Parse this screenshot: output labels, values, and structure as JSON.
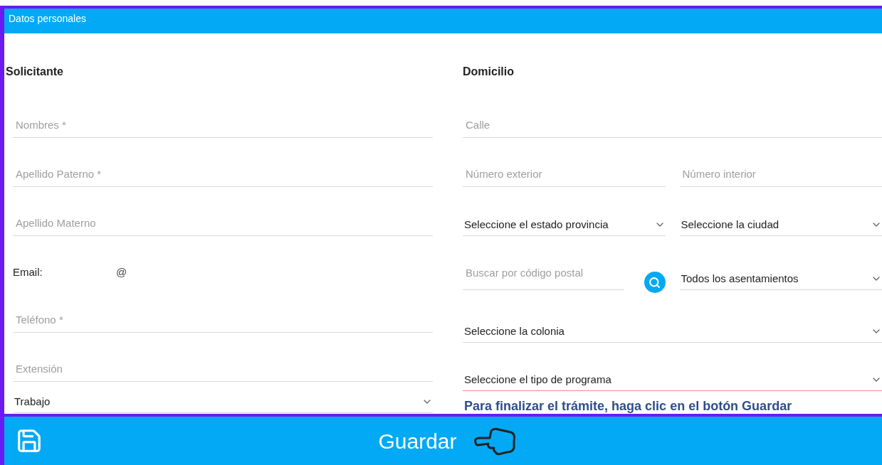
{
  "header": {
    "title": "Datos personales"
  },
  "applicant": {
    "heading": "Solicitante",
    "fields": [
      {
        "kind": "input",
        "placeholder": "Nombres *"
      },
      {
        "kind": "input",
        "placeholder": "Apellido Paterno *"
      },
      {
        "kind": "input",
        "placeholder": "Apellido Materno"
      },
      {
        "kind": "email",
        "label": "Email:",
        "at": "@"
      },
      {
        "kind": "input",
        "placeholder": "Teléfono *"
      },
      {
        "kind": "input",
        "placeholder": "Extensión"
      },
      {
        "kind": "select",
        "value": "Trabajo"
      }
    ]
  },
  "address": {
    "heading": "Domicilio",
    "rows": [
      [
        {
          "kind": "input",
          "placeholder": "Calle",
          "invalid": false
        }
      ],
      [
        {
          "kind": "input",
          "placeholder": "Número exterior",
          "invalid": false
        },
        {
          "kind": "input",
          "placeholder": "Número interior",
          "invalid": false
        }
      ],
      [
        {
          "kind": "select",
          "value": "Seleccione el estado provincia",
          "invalid": false
        },
        {
          "kind": "select",
          "value": "Seleccione la ciudad",
          "invalid": false
        }
      ],
      [
        {
          "kind": "postal",
          "placeholder": "Buscar por código postal",
          "invalid": false
        },
        {
          "kind": "select",
          "value": "Todos los asentamientos",
          "invalid": false
        }
      ],
      [
        {
          "kind": "select",
          "value": "Seleccione la colonia",
          "invalid": false
        }
      ],
      [
        {
          "kind": "select",
          "value": "Seleccione el tipo de programa",
          "invalid": true
        }
      ]
    ],
    "note": "Para finalizar el trámite, haga clic en el botón Guardar"
  },
  "footer": {
    "button": "Guardar"
  }
}
